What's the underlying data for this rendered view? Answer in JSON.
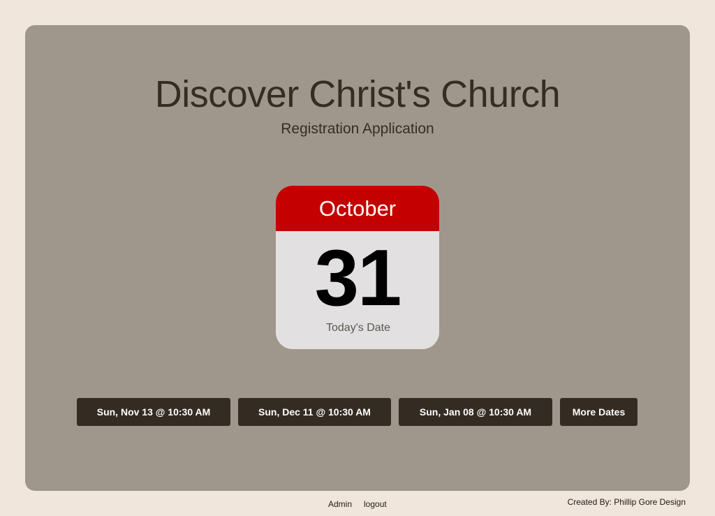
{
  "header": {
    "title": "Discover Christ's Church",
    "subtitle": "Registration Application"
  },
  "calendar": {
    "month": "October",
    "day": "31",
    "caption": "Today's Date",
    "accent_color": "#c40000"
  },
  "dates": {
    "buttons": [
      "Sun, Nov 13 @ 10:30 AM",
      "Sun, Dec 11 @ 10:30 AM",
      "Sun, Jan 08 @ 10:30 AM"
    ],
    "more_label": "More Dates"
  },
  "footer": {
    "admin_label": "Admin",
    "logout_label": "logout",
    "credit": "Created By: Phillip Gore Design"
  },
  "colors": {
    "page_background": "#f0e6db",
    "panel_background": "#a0978c",
    "button_background": "#342b22",
    "text_dark": "#362c23"
  }
}
